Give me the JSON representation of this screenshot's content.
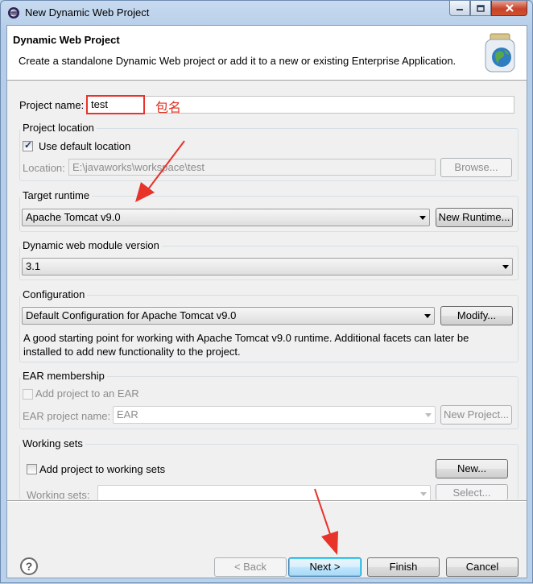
{
  "window": {
    "title": "New Dynamic Web Project"
  },
  "banner": {
    "title": "Dynamic Web Project",
    "description": "Create a standalone Dynamic Web project or add it to a new or existing Enterprise Application."
  },
  "project_name": {
    "label": "Project name:",
    "value": "test",
    "annotation": "包名",
    "annotation_color": "#e03020"
  },
  "project_location": {
    "group_title": "Project location",
    "use_default_label": "Use default location",
    "use_default_checked": true,
    "location_label": "Location:",
    "location_value": "E:\\javaworks\\workspace\\test",
    "browse_label": "Browse..."
  },
  "target_runtime": {
    "group_title": "Target runtime",
    "selected": "Apache Tomcat v9.0",
    "new_runtime_label": "New Runtime..."
  },
  "module_version": {
    "group_title": "Dynamic web module version",
    "selected": "3.1"
  },
  "configuration": {
    "group_title": "Configuration",
    "selected": "Default Configuration for Apache Tomcat v9.0",
    "modify_label": "Modify...",
    "description_line1": "A good starting point for working with Apache Tomcat v9.0 runtime. Additional facets can later be",
    "description_line2": "installed to add new functionality to the project."
  },
  "ear": {
    "group_title": "EAR membership",
    "add_label": "Add project to an EAR",
    "add_checked": false,
    "name_label": "EAR project name:",
    "name_value": "EAR",
    "new_project_label": "New Project..."
  },
  "working_sets": {
    "group_title": "Working sets",
    "add_label": "Add project to working sets",
    "add_checked": false,
    "new_label": "New...",
    "sets_label": "Working sets:",
    "sets_value": "",
    "select_label": "Select..."
  },
  "footer": {
    "help_icon": "help-icon",
    "back_label": "< Back",
    "next_label": "Next >",
    "finish_label": "Finish",
    "cancel_label": "Cancel"
  },
  "annotation_color": "#e8332a"
}
